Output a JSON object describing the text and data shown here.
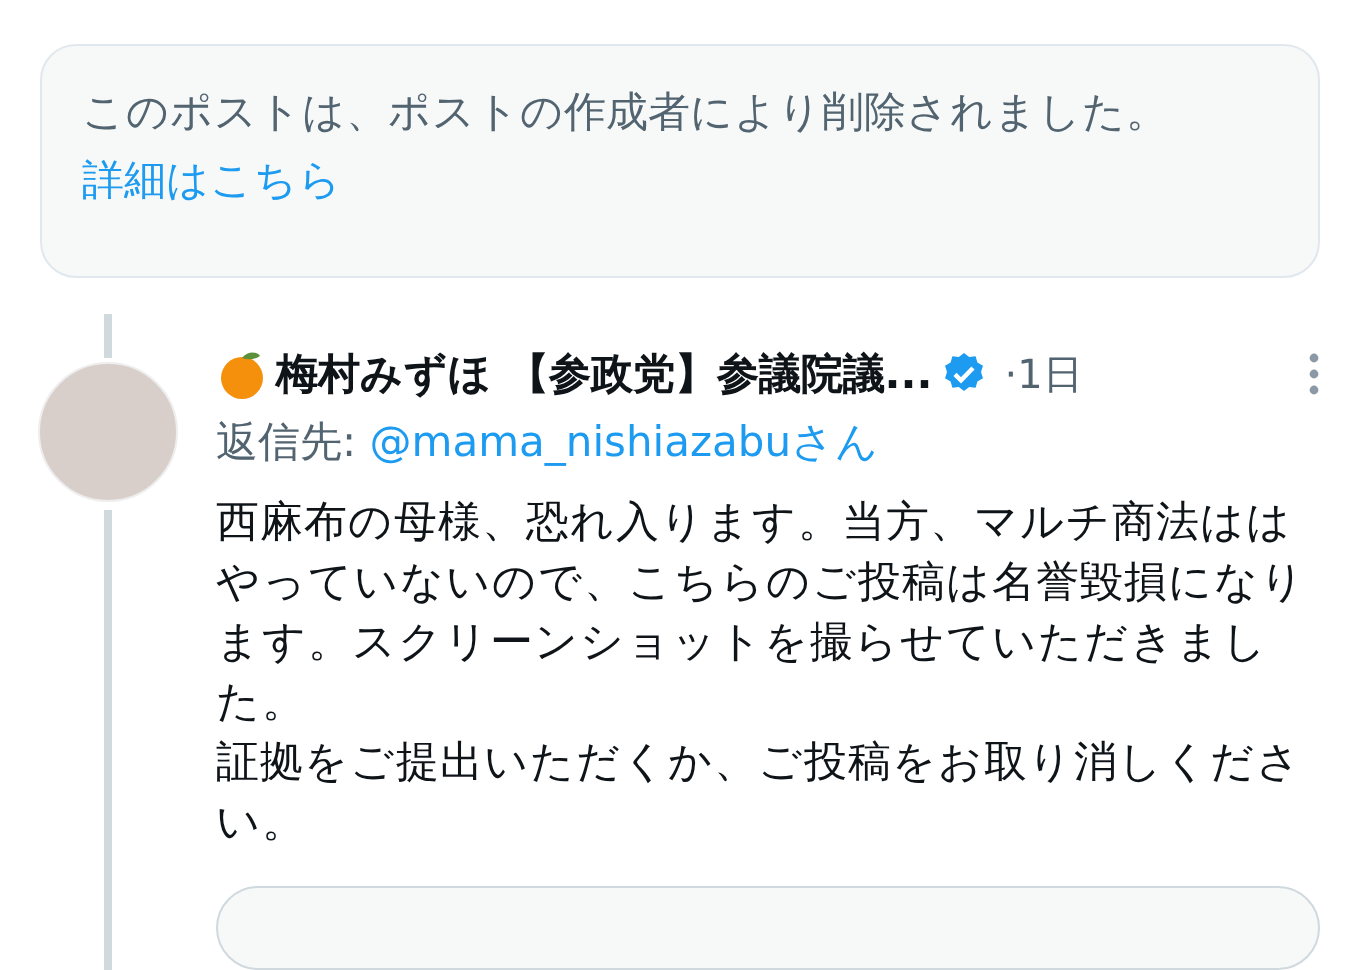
{
  "deleted_notice": {
    "text": "このポストは、ポストの作成者により削除されました。",
    "link": "詳細はこちら"
  },
  "reply": {
    "name": "梅村みずほ 【参政党】参議院議...",
    "verified": true,
    "time": "·1日",
    "reply_to_label": "返信先:",
    "reply_to_handle": "@mama_nishiazabuさん",
    "body": [
      "西麻布の母様、恐れ入ります。当方、マルチ商法ははやっていないので、こちらのご投稿は名誉毀損になります。スクリーンショットを撮らせていただきました。",
      "証拠をご提出いただくか、ご投稿をお取り消しください。"
    ]
  }
}
